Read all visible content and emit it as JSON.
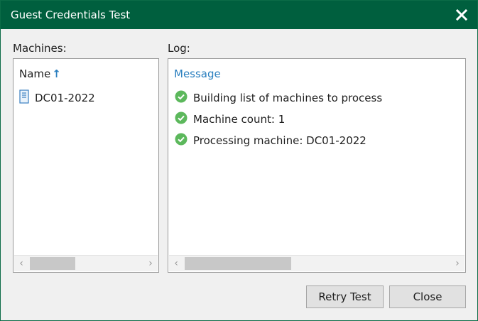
{
  "window": {
    "title": "Guest Credentials Test"
  },
  "machines": {
    "label": "Machines:",
    "column_header": "Name",
    "items": [
      {
        "name": "DC01-2022",
        "icon": "server-icon"
      }
    ]
  },
  "log": {
    "label": "Log:",
    "column_header": "Message",
    "entries": [
      {
        "status": "success",
        "message": "Building list of machines to process"
      },
      {
        "status": "success",
        "message": "Machine count: 1"
      },
      {
        "status": "success",
        "message": "Processing machine: DC01-2022"
      }
    ]
  },
  "buttons": {
    "retry": "Retry Test",
    "close": "Close"
  },
  "colors": {
    "titlebar": "#005f3e",
    "success": "#5cb85c",
    "link": "#2a7fbf"
  }
}
